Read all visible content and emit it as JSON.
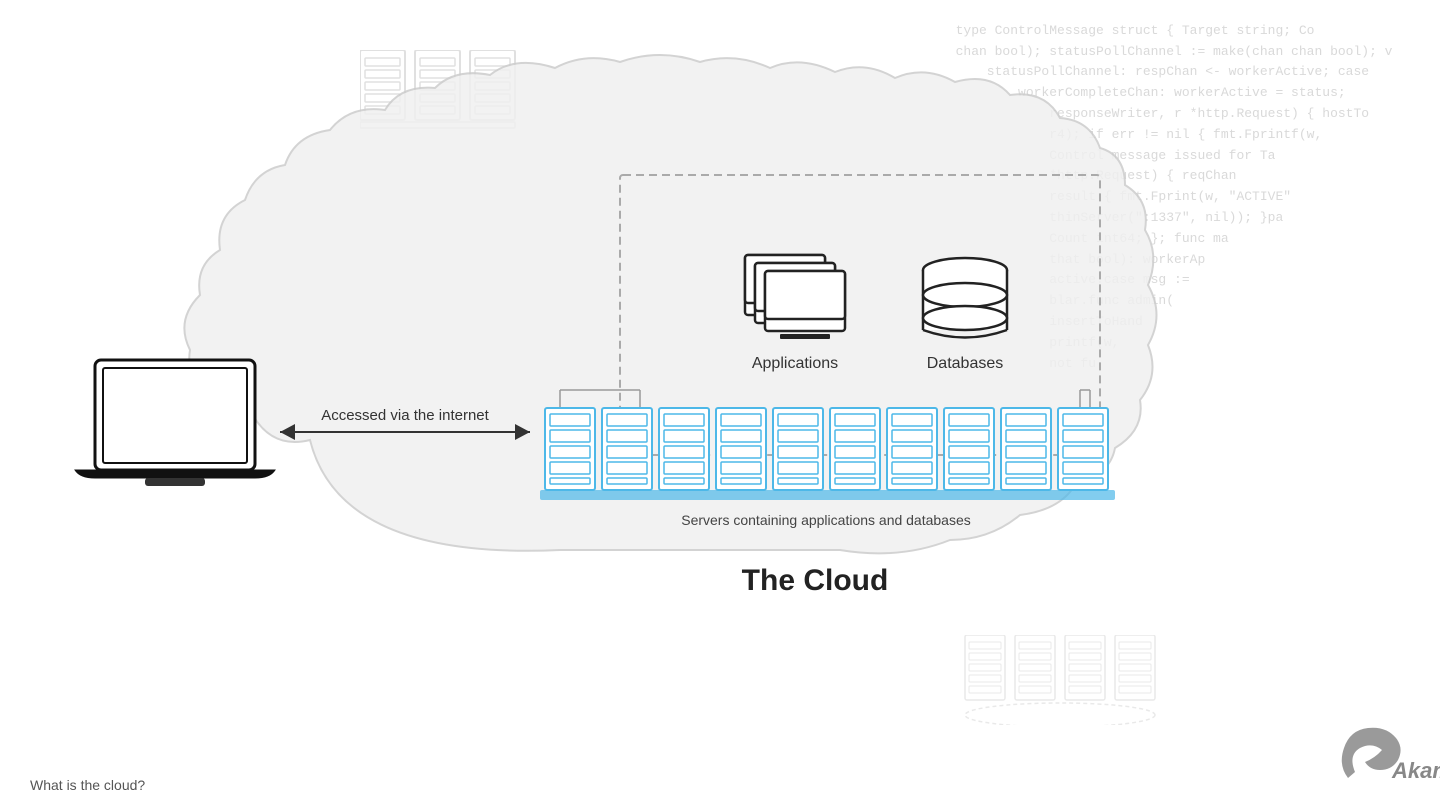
{
  "code_bg": {
    "lines": "type ControlMessage struct { Target string; Co\nchan bool); statusPollChannel := make(chan chan bool); v\n    statusPollChannel: respChan <- workerActive; case\n        workerCompleteChan: workerActive = status;\n            responseWriter, r *http.Request) { hostTo\n            r4); if err != nil { fmt.Fprintf(w,\n            Control message issued for Ta\n            *http.Request) { reqChan\n            result { fmt.Fprint(w, \"ACTIVE\"\n            thinServer(\":1337\", nil)); }pa\n            Count int64; }; func ma\n            that bool): workerAp\n            active:case msg :=\n            blar.func admin(\n            insertToHand\n            printf(w,\n            not fu"
  },
  "labels": {
    "applications": "Applications",
    "databases": "Databases",
    "accessed_via": "Accessed via the internet",
    "servers_caption": "Servers containing applications and databases",
    "cloud_title": "The Cloud",
    "footer": "What is the cloud?",
    "akamai": "Akamai"
  },
  "colors": {
    "blue_server": "#4db8e8",
    "dashed_border": "#aaaaaa",
    "cloud_fill": "#f8f8f8",
    "cloud_stroke": "#cccccc",
    "text_dark": "#222222",
    "text_mid": "#444444",
    "code_color": "rgba(180,180,180,0.45)"
  }
}
